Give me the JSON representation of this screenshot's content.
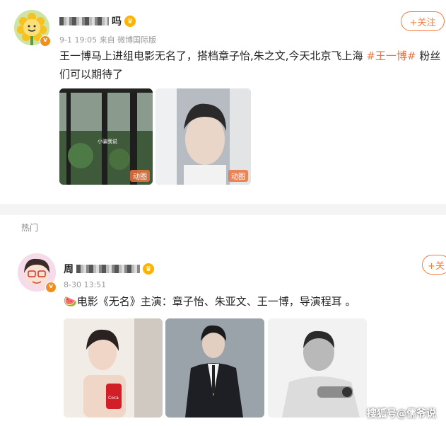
{
  "post1": {
    "name_suffix": "吗",
    "meta": "9-1 19:05  来自 微博国际版",
    "follow_label": "+关注",
    "text_before": "王一博马上进组电影无名了，搭档章子怡,朱之文,今天北京飞上海 ",
    "hashtag": "#王一博#",
    "text_after": " 粉丝们可以期待了",
    "gif_label_1": "动图",
    "gif_label_2": "动图",
    "thumb1_caption": "小骗我说"
  },
  "section": {
    "hot_label": "热门"
  },
  "post2": {
    "name_prefix": "周",
    "meta": "8-30 13:51",
    "follow_label": "+关",
    "emoji": "🍉",
    "text": "电影《无名》主演：章子怡、朱亚文、王一博，导演程耳 。"
  },
  "watermark": "搜狐号@儒爷说",
  "colors": {
    "accent": "#eb7340",
    "verified_badge": "#f08f1f"
  }
}
